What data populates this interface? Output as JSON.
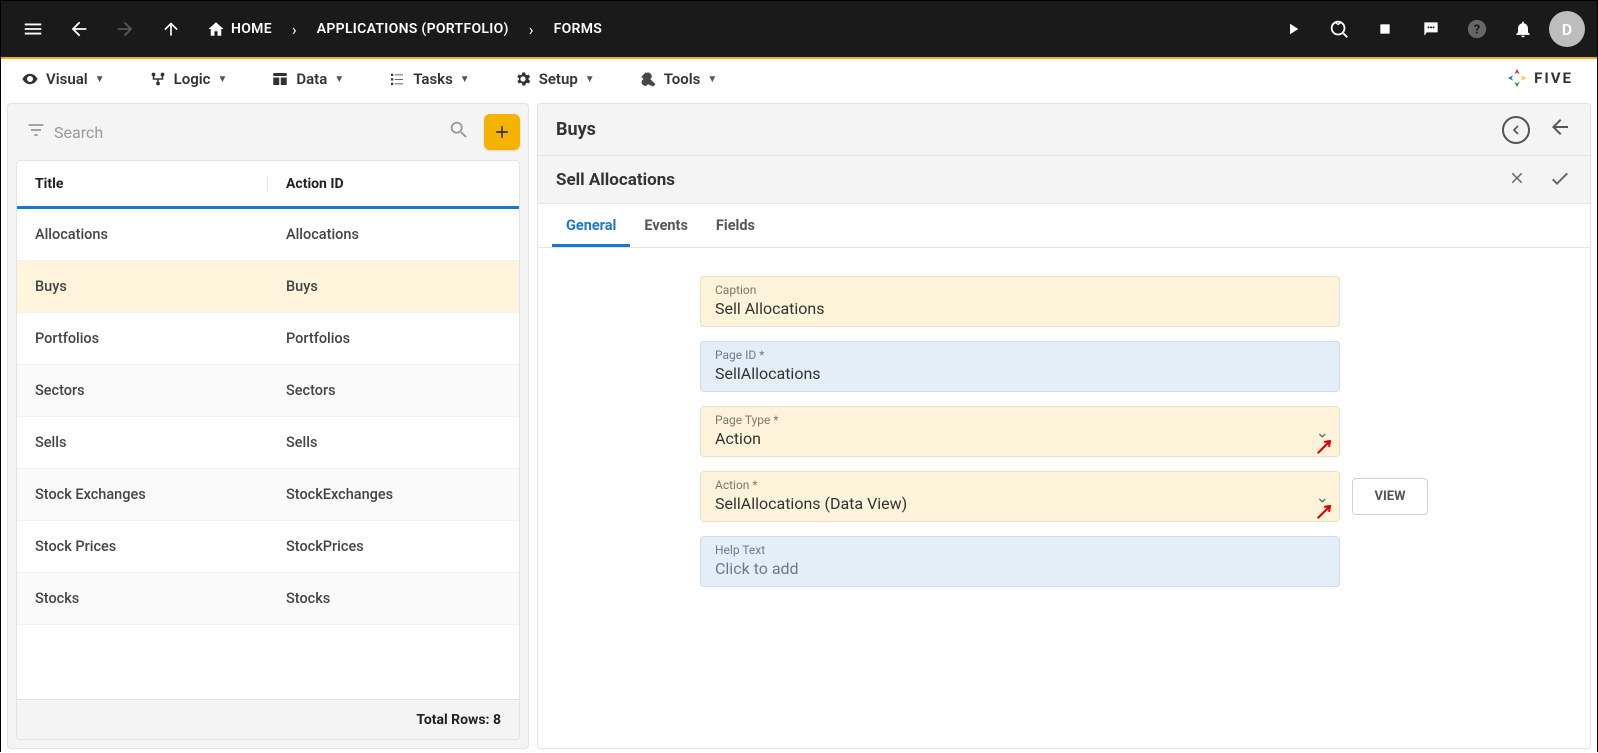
{
  "topbar": {
    "breadcrumbs": [
      {
        "label": "HOME",
        "icon": "home"
      },
      {
        "label": "APPLICATIONS (PORTFOLIO)"
      },
      {
        "label": "FORMS"
      }
    ],
    "avatar_letter": "D"
  },
  "toolbar": {
    "items": [
      {
        "label": "Visual"
      },
      {
        "label": "Logic"
      },
      {
        "label": "Data"
      },
      {
        "label": "Tasks"
      },
      {
        "label": "Setup"
      },
      {
        "label": "Tools"
      }
    ],
    "brand": "FIVE"
  },
  "left_panel": {
    "search_placeholder": "Search",
    "headers": {
      "col1": "Title",
      "col2": "Action ID"
    },
    "rows": [
      {
        "title": "Allocations",
        "action_id": "Allocations",
        "selected": false
      },
      {
        "title": "Buys",
        "action_id": "Buys",
        "selected": true
      },
      {
        "title": "Portfolios",
        "action_id": "Portfolios",
        "selected": false
      },
      {
        "title": "Sectors",
        "action_id": "Sectors",
        "selected": false
      },
      {
        "title": "Sells",
        "action_id": "Sells",
        "selected": false
      },
      {
        "title": "Stock Exchanges",
        "action_id": "StockExchanges",
        "selected": false
      },
      {
        "title": "Stock Prices",
        "action_id": "StockPrices",
        "selected": false
      },
      {
        "title": "Stocks",
        "action_id": "Stocks",
        "selected": false
      }
    ],
    "footer_label": "Total Rows:",
    "footer_count": "8"
  },
  "right_panel": {
    "header1_title": "Buys",
    "header2_title": "Sell Allocations",
    "tabs": [
      {
        "label": "General",
        "active": true
      },
      {
        "label": "Events",
        "active": false
      },
      {
        "label": "Fields",
        "active": false
      }
    ],
    "fields": {
      "caption": {
        "label": "Caption",
        "value": "Sell Allocations"
      },
      "page_id": {
        "label": "Page ID *",
        "value": "SellAllocations"
      },
      "page_type": {
        "label": "Page Type *",
        "value": "Action"
      },
      "action": {
        "label": "Action *",
        "value": "SellAllocations (Data View)"
      },
      "help_text": {
        "label": "Help Text",
        "value": "Click to add"
      }
    },
    "view_button": "VIEW"
  }
}
